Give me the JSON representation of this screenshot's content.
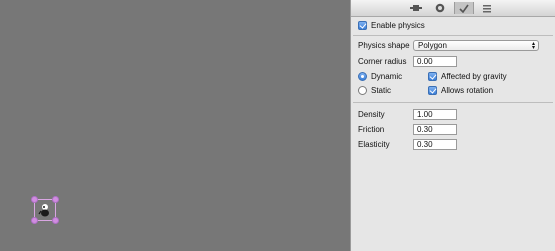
{
  "toolbar": {
    "icons": [
      "node-properties-icon",
      "physics-icon",
      "checkmark-icon",
      "layers-icon"
    ],
    "active_icon": "physics-icon"
  },
  "physics": {
    "enable_label": "Enable physics",
    "enable_checked": true,
    "shape_label": "Physics shape",
    "shape_value": "Polygon",
    "corner_radius_label": "Corner radius",
    "corner_radius_value": "0.00",
    "dynamic_label": "Dynamic",
    "static_label": "Static",
    "body_type": "Dynamic",
    "gravity_label": "Affected by gravity",
    "gravity_checked": true,
    "rotation_label": "Allows rotation",
    "rotation_checked": true,
    "density_label": "Density",
    "density_value": "1.00",
    "friction_label": "Friction",
    "friction_value": "0.30",
    "elasticity_label": "Elasticity",
    "elasticity_value": "0.30"
  },
  "colors": {
    "canvas": "#777777",
    "selection_handle": "#d08de0",
    "check_blue": "#3b7fd9"
  }
}
